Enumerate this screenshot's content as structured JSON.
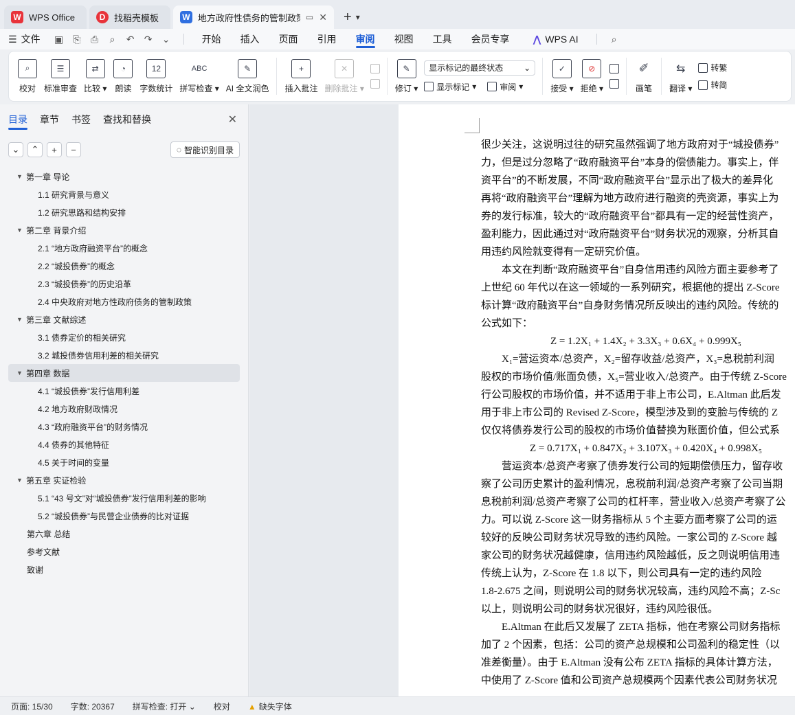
{
  "tabs": [
    {
      "label": "WPS Office"
    },
    {
      "label": "找稻壳模板"
    },
    {
      "label": "地方政府性债务的管制政策与债务"
    }
  ],
  "menu": {
    "file": "文件",
    "items": [
      "开始",
      "插入",
      "页面",
      "引用",
      "审阅",
      "视图",
      "工具",
      "会员专享"
    ],
    "active": "审阅",
    "ai": "WPS AI"
  },
  "ribbon": {
    "proofread": "校对",
    "std_review": "标准审查",
    "compare": "比较",
    "read_aloud": "朗读",
    "word_count": "字数统计",
    "spell_check": "拼写检查",
    "ai_polish": "AI 全文润色",
    "insert_comment": "插入批注",
    "delete_comment": "删除批注",
    "revise": "修订",
    "markup_dropdown": "显示标记的最终状态",
    "show_markup": "显示标记",
    "review": "审阅",
    "accept": "接受",
    "reject": "拒绝",
    "pen": "画笔",
    "translate": "翻译",
    "to_traditional": "转繁",
    "to_simplified": "转简",
    "wordcount_icon": "12",
    "spell_icon": "ABC"
  },
  "leftpane": {
    "tabs": [
      "目录",
      "章节",
      "书签",
      "查找和替换"
    ],
    "smart_button": "智能识别目录",
    "toc": [
      {
        "level": 1,
        "text": "第一章  导论",
        "arrow": true
      },
      {
        "level": 2,
        "text": "1.1  研究背景与意义"
      },
      {
        "level": 2,
        "text": "1.2  研究思路和结构安排"
      },
      {
        "level": 1,
        "text": "第二章  背景介绍",
        "arrow": true
      },
      {
        "level": 2,
        "text": "2.1 “地方政府融资平台”的概念"
      },
      {
        "level": 2,
        "text": "2.2 “城投债券”的概念"
      },
      {
        "level": 2,
        "text": "2.3 “城投债券”的历史沿革"
      },
      {
        "level": 2,
        "text": "2.4 中央政府对地方性政府债务的管制政策"
      },
      {
        "level": 1,
        "text": "第三章  文献综述",
        "arrow": true
      },
      {
        "level": 2,
        "text": "3.1  债券定价的相关研究"
      },
      {
        "level": 2,
        "text": "3.2  城投债券信用利差的相关研究"
      },
      {
        "level": 1,
        "text": "第四章  数据",
        "arrow": true,
        "selected": true
      },
      {
        "level": 2,
        "text": "4.1 “城投债券”发行信用利差"
      },
      {
        "level": 2,
        "text": "4.2 地方政府财政情况"
      },
      {
        "level": 2,
        "text": "4.3 “政府融资平台”的财务情况"
      },
      {
        "level": 2,
        "text": "4.4 债券的其他特征"
      },
      {
        "level": 2,
        "text": "4.5 关于时间的变量"
      },
      {
        "level": 1,
        "text": "第五章  实证检验",
        "arrow": true
      },
      {
        "level": 2,
        "text": "5.1 “43 号文”对“城投债券”发行信用利差的影响"
      },
      {
        "level": 2,
        "text": "5.2 “城投债券”与民营企业债券的比对证据"
      },
      {
        "level": 1,
        "text": "第六章  总结",
        "arrow": false
      },
      {
        "level": 1,
        "text": "参考文献",
        "arrow": false
      },
      {
        "level": 1,
        "text": "致谢",
        "arrow": false
      }
    ]
  },
  "document": {
    "lines": [
      {
        "text": "很少关注，这说明过往的研究虽然强调了地方政府对于“城投债券”",
        "type": "p"
      },
      {
        "text": "力，但是过分忽略了“政府融资平台”本身的偿债能力。事实上，伴",
        "type": "p"
      },
      {
        "text": "资平台”的不断发展，不同“政府融资平台”显示出了极大的差异化",
        "type": "p"
      },
      {
        "text": "再将“政府融资平台”理解为地方政府进行融资的壳资源，事实上为",
        "type": "p"
      },
      {
        "text": "券的发行标准，较大的“政府融资平台”都具有一定的经营性资产，",
        "type": "p"
      },
      {
        "text": "盈利能力，因此通过对“政府融资平台”财务状况的观察，分析其自",
        "type": "p"
      },
      {
        "text": "用违约风险就变得有一定研究价值。",
        "type": "p"
      },
      {
        "text": "　　本文在判断“政府融资平台”自身信用违约风险方面主要参考了",
        "type": "p"
      },
      {
        "text": "上世纪 60 年代以在这一领域的一系列研究，根据他的提出 Z-Score",
        "type": "p"
      },
      {
        "text": "标计算“政府融资平台”自身财务情况所反映出的违约风险。传统的",
        "type": "p"
      },
      {
        "text": "公式如下：",
        "type": "p"
      },
      {
        "text": "Z = 1.2X₁ + 1.4X₂ + 3.3X₃ + 0.6X₄ + 0.999X₅",
        "type": "formula"
      },
      {
        "text": "　　X₁=营运资本/总资产，X₂=留存收益/总资产，X₃=息税前利润",
        "type": "p"
      },
      {
        "text": "股权的市场价值/账面负债，X₅=营业收入/总资产。由于传统 Z-Score",
        "type": "p"
      },
      {
        "text": "行公司股权的市场价值，并不适用于非上市公司，E.Altman 此后发",
        "type": "p"
      },
      {
        "text": "用于非上市公司的 Revised Z-Score，模型涉及到的变脸与传统的 Z",
        "type": "p"
      },
      {
        "text": "仅仅将债券发行公司的股权的市场价值替换为账面价值，但公式系",
        "type": "p"
      },
      {
        "text": "Z = 0.717X₁ + 0.847X₂ + 3.107X₃ + 0.420X₄ + 0.998X₅",
        "type": "formula"
      },
      {
        "text": "　　营运资本/总资产考察了债券发行公司的短期偿债压力，留存收",
        "type": "p"
      },
      {
        "text": "察了公司历史累计的盈利情况，息税前利润/总资产考察了公司当期",
        "type": "p"
      },
      {
        "text": "息税前利润/总资产考察了公司的杠杆率，营业收入/总资产考察了公",
        "type": "p"
      },
      {
        "text": "力。可以说 Z-Score 这一财务指标从 5 个主要方面考察了公司的运",
        "type": "p"
      },
      {
        "text": "较好的反映公司财务状况导致的违约风险。一家公司的 Z-Score 越",
        "type": "p"
      },
      {
        "text": "家公司的财务状况越健康，信用违约风险越低，反之则说明信用违",
        "type": "p"
      },
      {
        "text": "传统上认为，Z-Score 在 1.8 以下，则公司具有一定的违约风险",
        "type": "p"
      },
      {
        "text": "1.8-2.675 之间，则说明公司的财务状况较高，违约风险不高；Z-Sc",
        "type": "p"
      },
      {
        "text": "以上，则说明公司的财务状况很好，违约风险很低。",
        "type": "p"
      },
      {
        "text": "　　E.Altman 在此后又发展了 ZETA 指标，他在考察公司财务指标",
        "type": "p"
      },
      {
        "text": "加了 2 个因素，包括：公司的资产总规模和公司盈利的稳定性（以",
        "type": "p"
      },
      {
        "text": "准差衡量）。由于 E.Altman 没有公布 ZETA 指标的具体计算方法，",
        "type": "p"
      },
      {
        "text": "中使用了 Z-Score 值和公司资产总规模两个因素代表公司财务状况",
        "type": "p"
      }
    ]
  },
  "status": {
    "page": "页面: 15/30",
    "words": "字数: 20367",
    "spell": "拼写检查: 打开",
    "proof": "校对",
    "missing_font": "缺失字体"
  }
}
